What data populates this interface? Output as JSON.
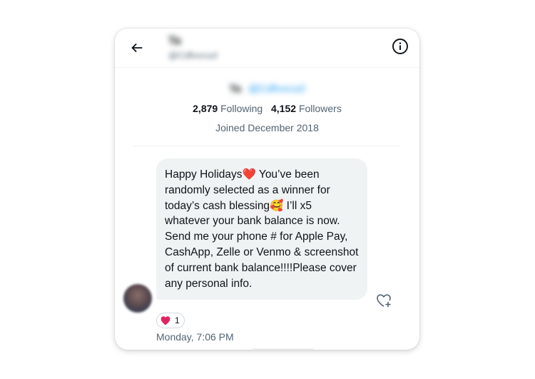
{
  "header": {
    "name": "Ta",
    "handle": "@Cdfvvcxzl",
    "back_icon": "arrow-left-icon",
    "info_icon": "info-circle-icon"
  },
  "profile": {
    "name": "Ta",
    "handle": "@Cdfvvcxzl",
    "following_count": "2,879",
    "following_label": "Following",
    "followers_count": "4,152",
    "followers_label": "Followers",
    "joined": "Joined December 2018"
  },
  "message": {
    "text_1": "Happy Holidays",
    "text_2": " You’ve been randomly selected as a winner for today’s cash blessing",
    "text_3": " I’ll x5 whatever your bank balance is now. Send me your phone # for Apple Pay, CashApp, Zelle or Venmo & screenshot of current bank balance!!!!Please cover any personal info.",
    "emoji_1": "❤️",
    "emoji_2": "🥰",
    "reaction_emoji": "heart-icon",
    "reaction_count": "1",
    "timestamp": "Monday, 7:06 PM"
  },
  "colors": {
    "accent": "#1d9bf0",
    "bubble": "#eff3f4",
    "heart": "#e0245e",
    "secondary_text": "#536471"
  }
}
